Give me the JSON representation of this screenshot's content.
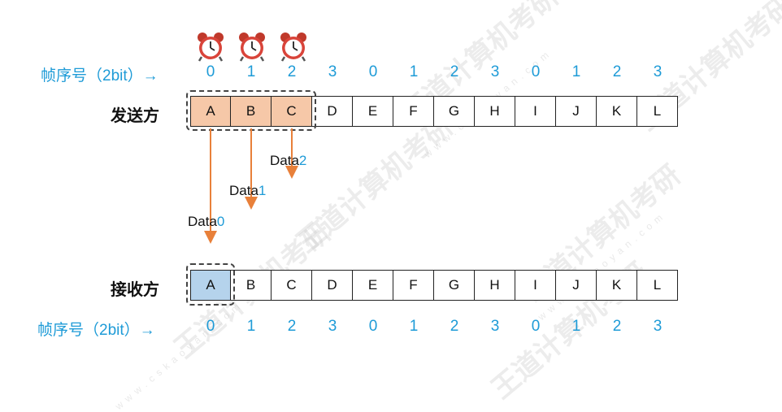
{
  "sender": {
    "label": "发送方",
    "seq_label": "帧序号（2bit）→",
    "seq_numbers": [
      "0",
      "1",
      "2",
      "3",
      "0",
      "1",
      "2",
      "3",
      "0",
      "1",
      "2",
      "3"
    ],
    "frames": [
      "A",
      "B",
      "C",
      "D",
      "E",
      "F",
      "G",
      "H",
      "I",
      "J",
      "K",
      "L"
    ],
    "window_frames": 3,
    "timers": 3
  },
  "receiver": {
    "label": "接收方",
    "seq_label": "帧序号（2bit）→",
    "seq_numbers": [
      "0",
      "1",
      "2",
      "3",
      "0",
      "1",
      "2",
      "3",
      "0",
      "1",
      "2",
      "3"
    ],
    "frames": [
      "A",
      "B",
      "C",
      "D",
      "E",
      "F",
      "G",
      "H",
      "I",
      "J",
      "K",
      "L"
    ],
    "window_frames": 1
  },
  "transmissions": [
    {
      "prefix": "Data",
      "index": "0"
    },
    {
      "prefix": "Data",
      "index": "1"
    },
    {
      "prefix": "Data",
      "index": "2"
    }
  ],
  "colors": {
    "sent_fill": "#f6c8a8",
    "recv_fill": "#b5d3ec",
    "arrow": "#e8803a",
    "seq_text": "#1e9bd7"
  },
  "icons": {
    "timer": "alarm-clock-icon"
  },
  "watermark": {
    "text": "王道计算机考研",
    "url": "www.cskaoyan.com"
  }
}
